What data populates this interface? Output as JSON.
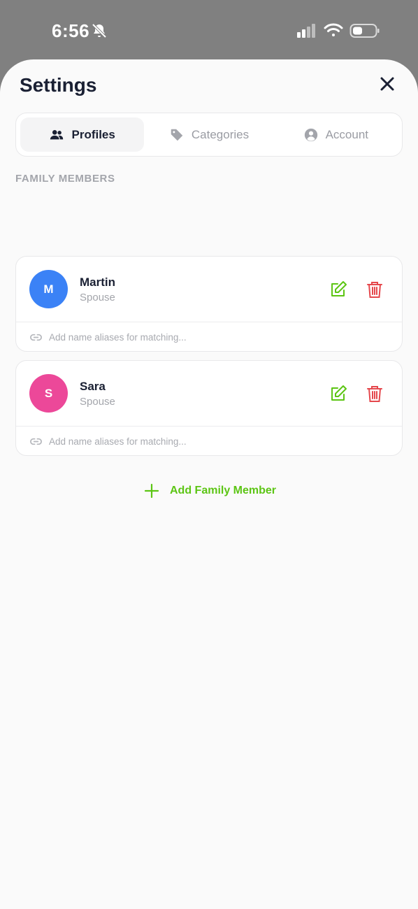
{
  "status_bar": {
    "time": "6:56"
  },
  "header": {
    "title": "Settings"
  },
  "tabs": [
    {
      "label": "Profiles",
      "icon": "users-icon",
      "active": true
    },
    {
      "label": "Categories",
      "icon": "tag-icon",
      "active": false
    },
    {
      "label": "Account",
      "icon": "user-circle-icon",
      "active": false
    }
  ],
  "section": {
    "label": "FAMILY MEMBERS"
  },
  "members": [
    {
      "initial": "M",
      "name": "Martin",
      "role": "Spouse",
      "avatar_color": "#3b82f6",
      "alias_placeholder": "Add name aliases for matching..."
    },
    {
      "initial": "S",
      "name": "Sara",
      "role": "Spouse",
      "avatar_color": "#ec4899",
      "alias_placeholder": "Add name aliases for matching..."
    }
  ],
  "add_member": {
    "label": "Add Family Member"
  },
  "colors": {
    "accent": "#5cc514",
    "danger": "#e5484d",
    "title": "#1a2033"
  }
}
